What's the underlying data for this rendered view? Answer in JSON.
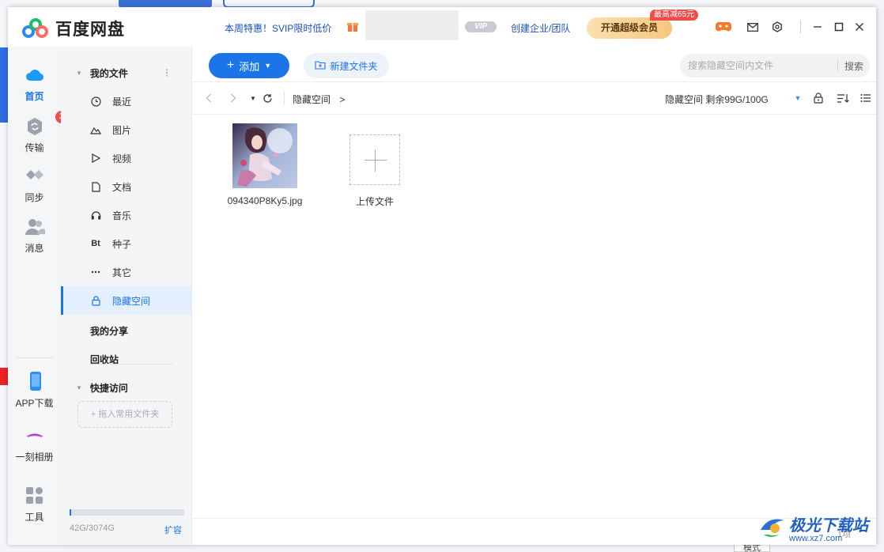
{
  "app": {
    "title": "百度网盘",
    "promo_text": "本周特惠！SVIP限时低价",
    "vip_pill": "VIP",
    "enterprise_link": "创建企业/团队",
    "vip_button": "开通超级会员",
    "vip_badge": "最高减65元"
  },
  "rail": {
    "items": [
      {
        "label": "首页",
        "icon": "cloud-home-icon"
      },
      {
        "label": "传输",
        "icon": "transfer-icon",
        "badge": "3"
      },
      {
        "label": "同步",
        "icon": "sync-icon"
      },
      {
        "label": "消息",
        "icon": "message-icon"
      },
      {
        "label": "APP下载",
        "icon": "phone-icon"
      },
      {
        "label": "一刻相册",
        "icon": "album-icon"
      },
      {
        "label": "工具",
        "icon": "tools-icon"
      }
    ]
  },
  "sidebar": {
    "my_files": "我的文件",
    "items": [
      {
        "label": "最近",
        "icon": "clock-icon"
      },
      {
        "label": "图片",
        "icon": "image-icon"
      },
      {
        "label": "视频",
        "icon": "play-icon"
      },
      {
        "label": "文档",
        "icon": "document-icon"
      },
      {
        "label": "音乐",
        "icon": "headphones-icon"
      },
      {
        "label": "种子",
        "icon": "bt-icon"
      },
      {
        "label": "其它",
        "icon": "more-icon"
      },
      {
        "label": "隐藏空间",
        "icon": "lock-icon"
      }
    ],
    "my_share": "我的分享",
    "recycle": "回收站",
    "quick_access": "快捷访问",
    "drop_hint": "+ 拖入常用文件夹",
    "quota": "42G/3074G",
    "expand": "扩容"
  },
  "toolbar": {
    "add_label": "添加",
    "new_folder_label": "新建文件夹",
    "search_placeholder": "搜索隐藏空间内文件",
    "search_button": "搜索"
  },
  "nav": {
    "breadcrumb": "隐藏空间",
    "breadcrumb_arrow": ">",
    "space_info": "隐藏空间 剩余99G/100G"
  },
  "files": [
    {
      "name": "094340P8Ky5.jpg"
    },
    {
      "name": "上传文件"
    }
  ],
  "footer": {
    "count": "1项"
  },
  "watermark": {
    "brand": "极光下载站",
    "url": "www.xz7.com"
  },
  "background": {
    "button_label": "模式"
  }
}
